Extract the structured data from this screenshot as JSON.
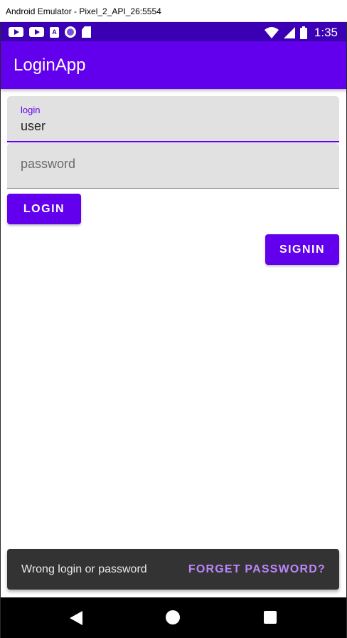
{
  "window": {
    "title": "Android Emulator - Pixel_2_API_26:5554"
  },
  "status_bar": {
    "time": "1:35",
    "icons_left": [
      "youtube-icon",
      "youtube-icon",
      "a-badge-icon",
      "circle-icon",
      "sd-card-icon"
    ],
    "icons_right": [
      "wifi-icon",
      "signal-icon",
      "battery-icon"
    ],
    "color": "#3b00b3"
  },
  "app_bar": {
    "title": "LoginApp",
    "color": "#6200ee"
  },
  "form": {
    "login": {
      "label": "login",
      "value": "user"
    },
    "password": {
      "placeholder": "password",
      "value": ""
    },
    "login_button": "LOGIN",
    "signin_button": "SIGNIN"
  },
  "snackbar": {
    "message": "Wrong login or password",
    "action": "FORGET PASSWORD?",
    "action_color": "#bb86fc"
  },
  "nav_bar": {
    "buttons": [
      "back",
      "home",
      "recents"
    ]
  },
  "colors": {
    "primary": "#6200ee",
    "primary_dark": "#3b00b3",
    "field_bg": "#e1e1e1"
  }
}
